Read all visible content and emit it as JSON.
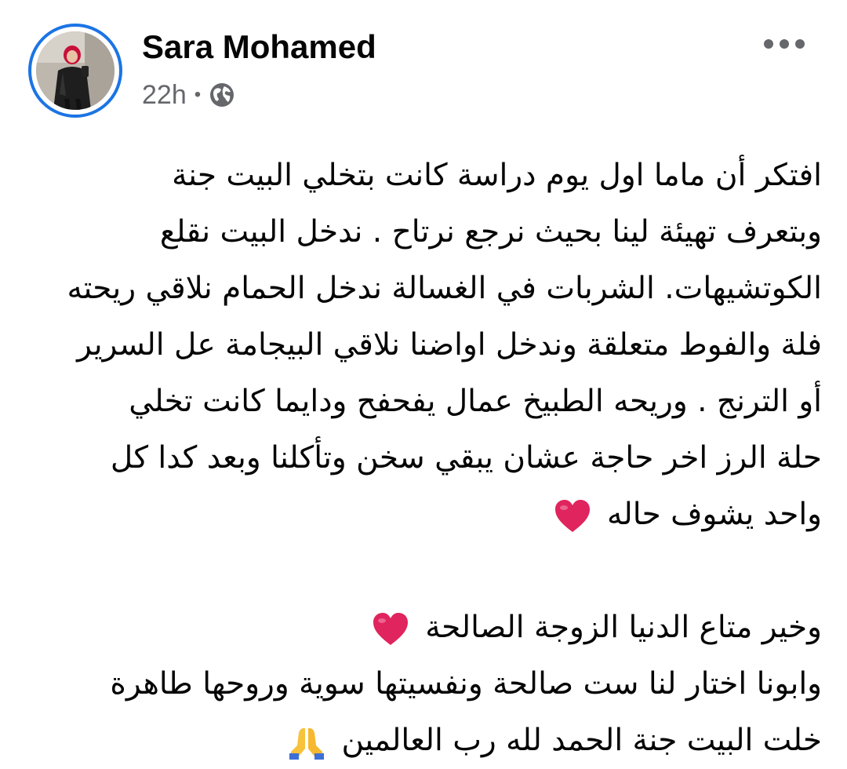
{
  "post": {
    "author_name": "Sara Mohamed",
    "time": "22h",
    "separator": "•",
    "privacy_icon": "globe-icon",
    "more_icon": "more-horizontal-icon"
  },
  "body": {
    "lines": [
      "افتكر أن ماما اول يوم دراسة كانت بتخلي البيت جنة",
      "وبتعرف تهيئة لينا بحيث نرجع نرتاح . ندخل البيت نقلع",
      "الكوتشيهات. الشربات في الغسالة ندخل الحمام نلاقي ريحته",
      "فلة والفوط متعلقة وندخل اواضنا نلاقي البيجامة عل السرير",
      "أو الترنج . وريحه الطبيخ عمال يفحفح ودايما كانت تخلي",
      "حلة الرز اخر حاجة عشان يبقي سخن وتأكلنا وبعد كدا كل",
      "واحد يشوف حاله"
    ],
    "lines2": [
      "وخير متاع الدنيا الزوجة الصالحة",
      "وابونا اختار لنا ست صالحة ونفسيتها سوية وروحها طاهرة",
      "خلت البيت جنة   الحمد لله رب العالمين"
    ],
    "heart_emoji": "red-heart-icon",
    "pray_emoji": "folded-hands-icon"
  },
  "colors": {
    "accent_ring": "#1b74e4",
    "meta_text": "#65676b",
    "heart": "#e0245e"
  }
}
